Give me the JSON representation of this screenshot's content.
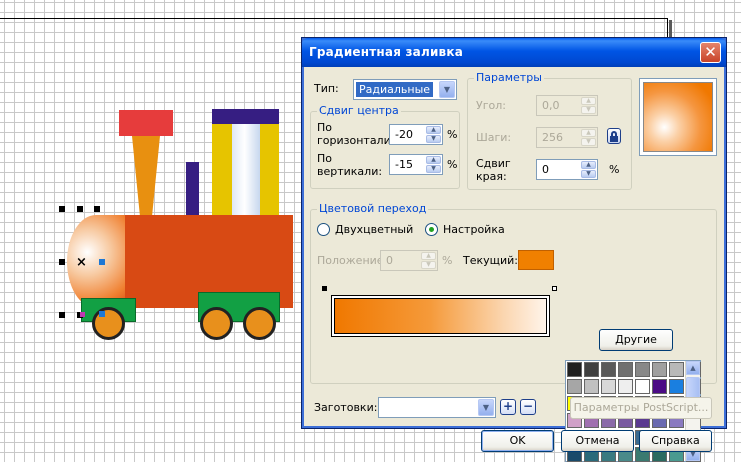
{
  "dialog": {
    "title": "Градиентная заливка",
    "close_label": "✕"
  },
  "type": {
    "label": "Тип:",
    "selected": "Радиальные"
  },
  "center_offset": {
    "legend": "Сдвиг центра",
    "horizontal_label_1": "По",
    "horizontal_label_2": "горизонтали:",
    "horizontal_value": "-20",
    "vertical_label_1": "По",
    "vertical_label_2": "вертикали:",
    "vertical_value": "-15",
    "percent": "%"
  },
  "parameters": {
    "legend": "Параметры",
    "angle_label": "Угол:",
    "angle_value": "0,0",
    "steps_label": "Шаги:",
    "steps_value": "256",
    "edge_label_1": "Сдвиг",
    "edge_label_2": "края:",
    "edge_value": "0",
    "percent": "%"
  },
  "color_transition": {
    "legend": "Цветовой переход",
    "two_color_label": "Двухцветный",
    "custom_label": "Настройка",
    "custom_selected": true,
    "position_label": "Положение:",
    "position_value": "0",
    "position_percent": "%",
    "current_label": "Текущий:",
    "current_color": "#f08000",
    "gradient_start": "#f07800",
    "gradient_end": "#fff4ea",
    "other_button": "Другие"
  },
  "preview": {
    "center_color": "#ffffff",
    "edge_color": "#f07800"
  },
  "palette": {
    "colors": [
      "#202020",
      "#404040",
      "#5a5a5a",
      "#707070",
      "#888888",
      "#a0a0a0",
      "#b8b8b8",
      "#d0d0d0",
      "#a6a6a6",
      "#c0c0c0",
      "#d8d8d8",
      "#eeeeee",
      "#ffffff",
      "#4b0b85",
      "#1a7fe0",
      "#0a8a3c",
      "#ffff00",
      "#e51c1c",
      "#f07800",
      "#8b1a2a",
      "#c41c8a",
      "#d83a64",
      "#7a3cb0",
      "#b64fc4",
      "#d0a0c8",
      "#a070b0",
      "#8a6aa8",
      "#7a5aa0",
      "#5a3a90",
      "#6a6ab0",
      "#8a7ac0",
      "#a06ab8",
      "#3a5a8a",
      "#2a7ac0",
      "#5aa0d8",
      "#4a8ab0",
      "#3a6a90",
      "#4a7aa0",
      "#7ab0d0",
      "#3aa0b0",
      "#1a4a6a",
      "#2a6a7a",
      "#3a7a80",
      "#4a8a8a",
      "#3a7a70",
      "#2a6a60",
      "#4a9a90",
      "#6a8a8a"
    ]
  },
  "presets": {
    "label": "Заготовки:",
    "value": "",
    "add_icon": "+",
    "remove_icon": "−",
    "postscript_button": "Параметры PostScript..."
  },
  "buttons": {
    "ok": "OK",
    "cancel": "Отмена",
    "help": "Справка"
  },
  "drawing": {
    "body_color": "#d84a14",
    "cab_color": "#e6c400",
    "roof_color": "#361e82",
    "chimney_top_color": "#e63c3c",
    "chimney_color": "#e89010",
    "pipe_color": "#361e82",
    "chassis_color": "#12a044",
    "wheel_color": "#e8901c",
    "selection_x": "×"
  }
}
